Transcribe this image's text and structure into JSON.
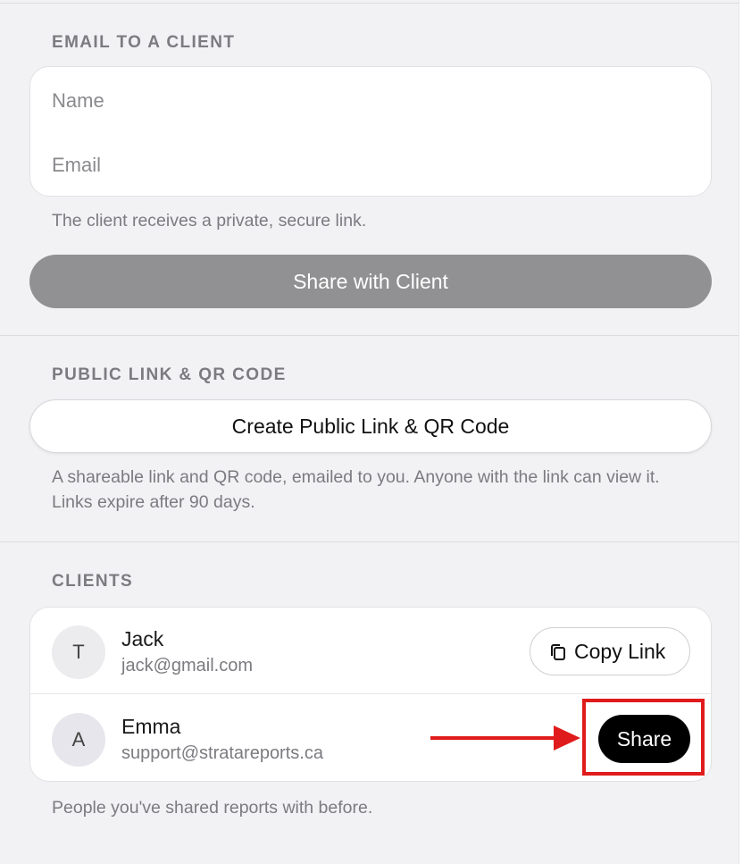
{
  "email_section": {
    "title": "EMAIL TO A CLIENT",
    "name_placeholder": "Name",
    "email_placeholder": "Email",
    "hint": "The client receives a private, secure link.",
    "share_button": "Share with Client"
  },
  "public_section": {
    "title": "PUBLIC LINK & QR CODE",
    "create_button": "Create Public Link & QR Code",
    "hint": "A shareable link and QR code, emailed to you. Anyone with the link can view it. Links expire after 90 days."
  },
  "clients_section": {
    "title": "CLIENTS",
    "items": [
      {
        "initial": "T",
        "name": "Jack",
        "email": "jack@gmail.com",
        "action": "Copy Link",
        "action_icon": "copy-icon"
      },
      {
        "initial": "A",
        "name": "Emma",
        "email": "support@stratareports.ca",
        "action": "Share"
      }
    ],
    "hint": "People you've shared reports with before."
  },
  "annotation": {
    "color": "#e01b1b",
    "target": "Share"
  }
}
